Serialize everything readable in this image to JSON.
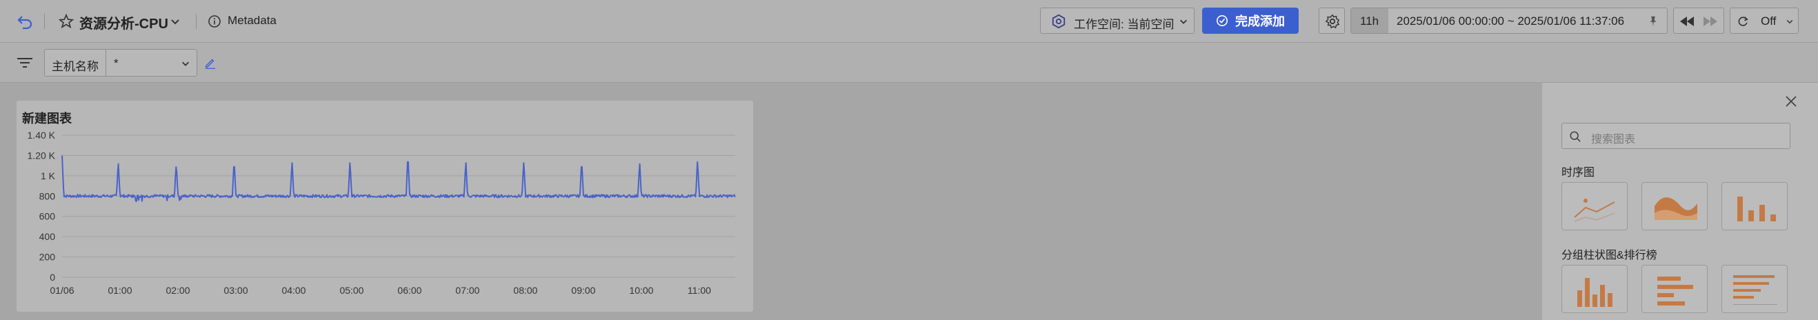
{
  "header": {
    "title": "资源分析-CPU",
    "metadata_label": "Metadata",
    "workspace_label": "工作空间: 当前空间",
    "done_label": "完成添加",
    "time_range_short": "11h",
    "time_range": "2025/01/06 00:00:00 ~ 2025/01/06 11:37:06",
    "refresh_label": "Off"
  },
  "filter": {
    "host_label": "主机名称",
    "host_value": "*"
  },
  "chart_panel": {
    "title": "新建图表"
  },
  "chart_data": {
    "type": "line",
    "title": "新建图表",
    "ylim": [
      0,
      1400
    ],
    "y_ticks": [
      "0",
      "200",
      "400",
      "600",
      "800",
      "1 K",
      "1.20 K",
      "1.40 K"
    ],
    "y_tick_values": [
      0,
      200,
      400,
      600,
      800,
      1000,
      1200,
      1400
    ],
    "x_ticks": [
      "01/06",
      "01:00",
      "02:00",
      "03:00",
      "04:00",
      "05:00",
      "06:00",
      "07:00",
      "08:00",
      "09:00",
      "10:00",
      "11:00"
    ],
    "x_range_hours": [
      0,
      11.62
    ],
    "baseline": 800,
    "spikes": [
      {
        "hour": 0.0,
        "value": 1200
      },
      {
        "hour": 0.97,
        "value": 1140
      },
      {
        "hour": 1.97,
        "value": 1150
      },
      {
        "hour": 2.97,
        "value": 1160
      },
      {
        "hour": 3.97,
        "value": 1150
      },
      {
        "hour": 4.97,
        "value": 1150
      },
      {
        "hour": 5.97,
        "value": 1220
      },
      {
        "hour": 6.97,
        "value": 1150
      },
      {
        "hour": 7.97,
        "value": 1150
      },
      {
        "hour": 8.97,
        "value": 1160
      },
      {
        "hour": 9.97,
        "value": 1140
      },
      {
        "hour": 10.97,
        "value": 1160
      }
    ],
    "color": "#4a63c9"
  },
  "sidebar": {
    "search_placeholder": "搜索图表",
    "section_timeseries": "时序图",
    "section_bars": "分组柱状图&排行榜"
  }
}
